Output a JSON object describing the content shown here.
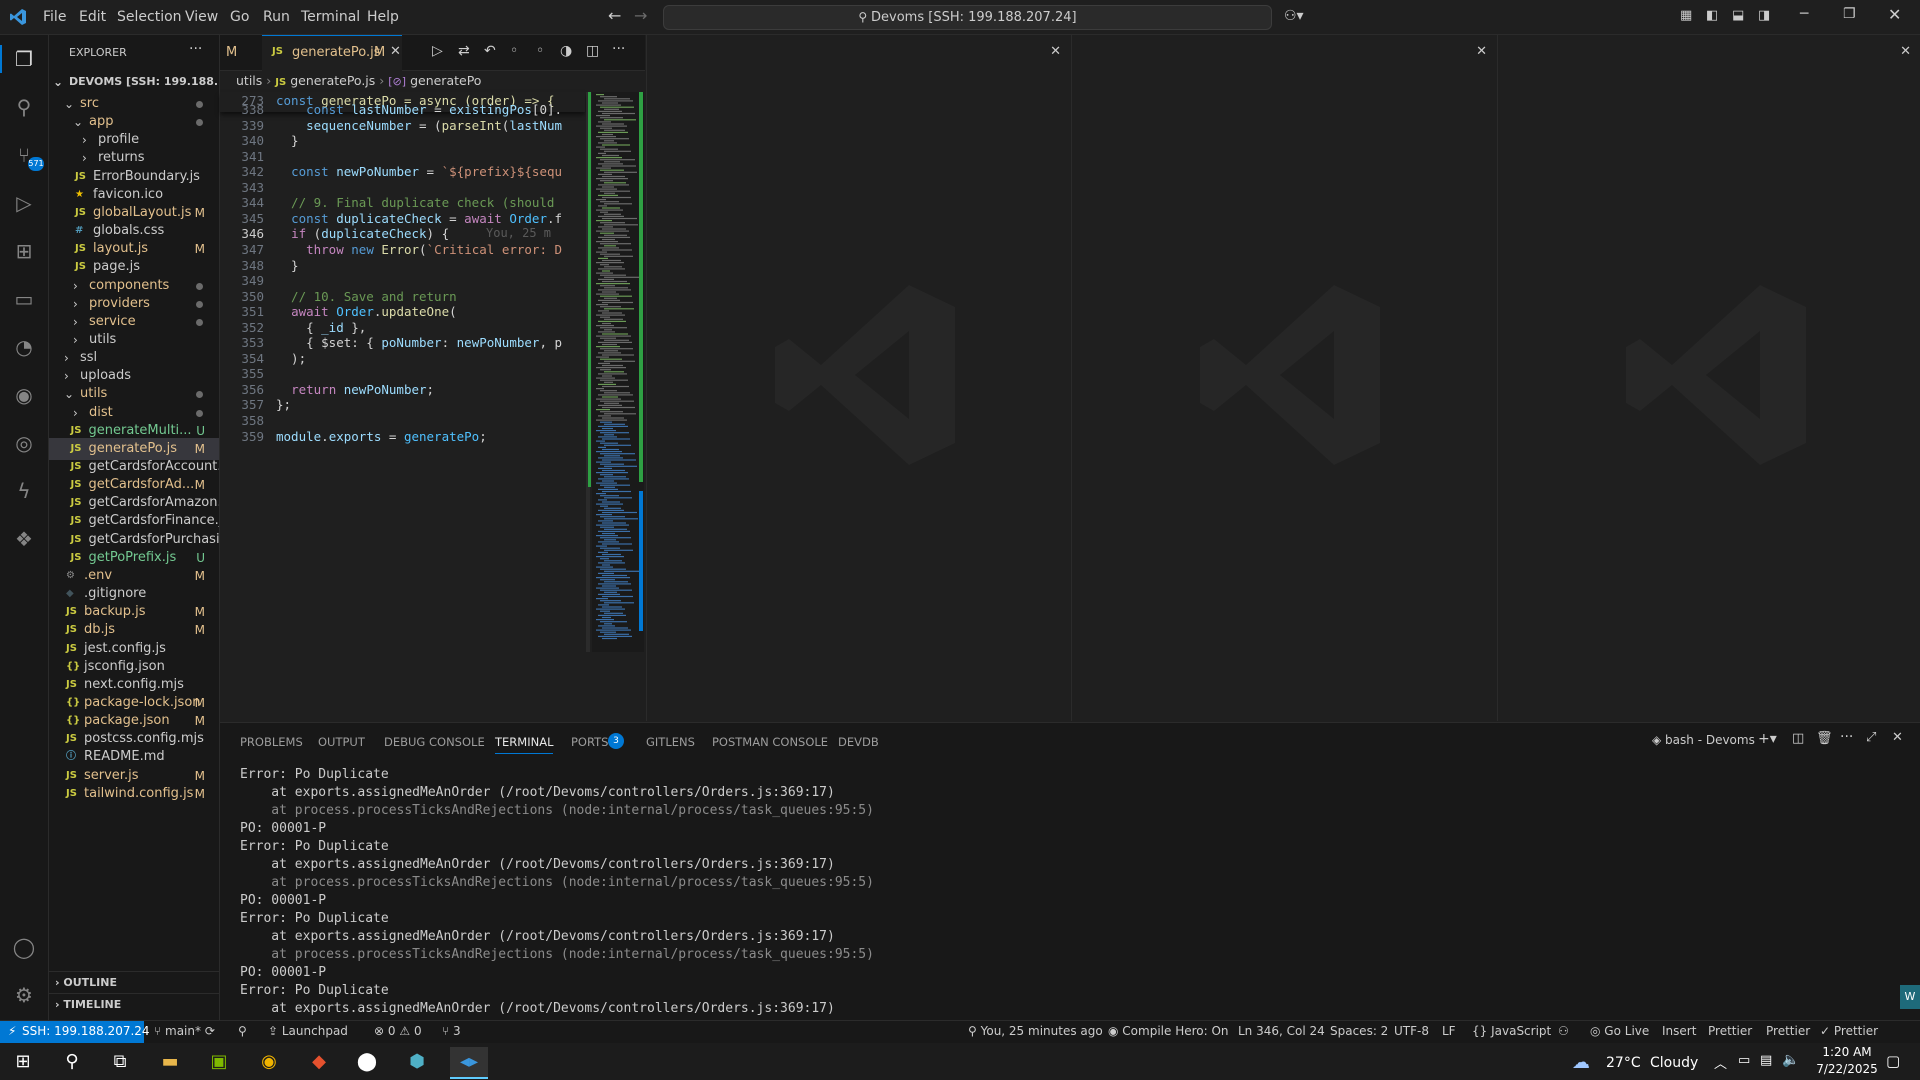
{
  "titlebar": {
    "menus": [
      "File",
      "Edit",
      "Selection",
      "View",
      "Go",
      "Run",
      "Terminal",
      "Help"
    ],
    "command_center": "Devoms [SSH: 199.188.207.24]"
  },
  "activity_bar": {
    "scm_badge": "571"
  },
  "sidebar": {
    "title": "EXPLORER",
    "root": "DEVOMS [SSH: 199.188.20...",
    "items": [
      {
        "label": "src",
        "status": "dot"
      },
      {
        "label": "app",
        "status": "dot"
      },
      {
        "label": "profile",
        "status": ""
      },
      {
        "label": "returns",
        "status": ""
      },
      {
        "label": "ErrorBoundary.js",
        "status": ""
      },
      {
        "label": "favicon.ico",
        "status": ""
      },
      {
        "label": "globalLayout.js",
        "status": "M"
      },
      {
        "label": "globals.css",
        "status": ""
      },
      {
        "label": "layout.js",
        "status": "M"
      },
      {
        "label": "page.js",
        "status": ""
      },
      {
        "label": "components",
        "status": "dot"
      },
      {
        "label": "providers",
        "status": "dot"
      },
      {
        "label": "service",
        "status": "dot"
      },
      {
        "label": "utils",
        "status": ""
      },
      {
        "label": "ssl",
        "status": ""
      },
      {
        "label": "uploads",
        "status": ""
      },
      {
        "label": "utils",
        "status": "dot"
      },
      {
        "label": "dist",
        "status": "dot"
      },
      {
        "label": "generateMulti...",
        "status": "U"
      },
      {
        "label": "generatePo.js",
        "status": "M"
      },
      {
        "label": "getCardsforAccount.js",
        "status": ""
      },
      {
        "label": "getCardsforAd...",
        "status": "M"
      },
      {
        "label": "getCardsforAmazon.js",
        "status": ""
      },
      {
        "label": "getCardsforFinance.js",
        "status": ""
      },
      {
        "label": "getCardsforPurchasi...",
        "status": ""
      },
      {
        "label": "getPoPrefix.js",
        "status": "U"
      },
      {
        "label": ".env",
        "status": "M"
      },
      {
        "label": ".gitignore",
        "status": ""
      },
      {
        "label": "backup.js",
        "status": "M"
      },
      {
        "label": "db.js",
        "status": "M"
      },
      {
        "label": "jest.config.js",
        "status": ""
      },
      {
        "label": "jsconfig.json",
        "status": ""
      },
      {
        "label": "next.config.mjs",
        "status": ""
      },
      {
        "label": "package-lock.json",
        "status": "M"
      },
      {
        "label": "package.json",
        "status": "M"
      },
      {
        "label": "postcss.config.mjs",
        "status": ""
      },
      {
        "label": "README.md",
        "status": ""
      },
      {
        "label": "server.js",
        "status": "M"
      },
      {
        "label": "tailwind.config.js",
        "status": "M"
      }
    ],
    "outline": "OUTLINE",
    "timeline": "TIMELINE"
  },
  "editor": {
    "prev_tab_status": "M",
    "tab_label": "generatePo.js",
    "tab_status": "M",
    "breadcrumb": [
      "utils",
      "generatePo.js",
      "generatePo"
    ],
    "sticky_line": "273",
    "sticky_code": "const generatePo = async (order) => {",
    "blame": "You, 25 m",
    "lines": [
      {
        "n": "338",
        "t": "    const lastNumber = existingPos[0]."
      },
      {
        "n": "339",
        "t": "    sequenceNumber = (parseInt(lastNum"
      },
      {
        "n": "340",
        "t": "  }"
      },
      {
        "n": "341",
        "t": ""
      },
      {
        "n": "342",
        "t": "  const newPoNumber = `${prefix}${sequ"
      },
      {
        "n": "343",
        "t": ""
      },
      {
        "n": "344",
        "t": "  // 9. Final duplicate check (should"
      },
      {
        "n": "345",
        "t": "  const duplicateCheck = await Order.f"
      },
      {
        "n": "346",
        "t": "  if (duplicateCheck) {"
      },
      {
        "n": "347",
        "t": "    throw new Error(`Critical error: D"
      },
      {
        "n": "348",
        "t": "  }"
      },
      {
        "n": "349",
        "t": ""
      },
      {
        "n": "350",
        "t": "  // 10. Save and return"
      },
      {
        "n": "351",
        "t": "  await Order.updateOne("
      },
      {
        "n": "352",
        "t": "    { _id },"
      },
      {
        "n": "353",
        "t": "    { $set: { poNumber: newPoNumber, p"
      },
      {
        "n": "354",
        "t": "  );"
      },
      {
        "n": "355",
        "t": ""
      },
      {
        "n": "356",
        "t": "  return newPoNumber;"
      },
      {
        "n": "357",
        "t": "};"
      },
      {
        "n": "358",
        "t": ""
      },
      {
        "n": "359",
        "t": "module.exports = generatePo;"
      }
    ]
  },
  "panel": {
    "tabs": [
      "PROBLEMS",
      "OUTPUT",
      "DEBUG CONSOLE",
      "TERMINAL",
      "PORTS",
      "GITLENS",
      "POSTMAN CONSOLE",
      "DEVDB"
    ],
    "active_tab": "TERMINAL",
    "ports_badge": "3",
    "terminal_name": "bash - Devoms",
    "terminal_lines": [
      "Error: Po Duplicate",
      "    at exports.assignedMeAnOrder (/root/Devoms/controllers/Orders.js:369:17)",
      "    at process.processTicksAndRejections (node:internal/process/task_queues:95:5)",
      "PO: 00001-P",
      "Error: Po Duplicate",
      "    at exports.assignedMeAnOrder (/root/Devoms/controllers/Orders.js:369:17)",
      "    at process.processTicksAndRejections (node:internal/process/task_queues:95:5)",
      "PO: 00001-P",
      "Error: Po Duplicate",
      "    at exports.assignedMeAnOrder (/root/Devoms/controllers/Orders.js:369:17)",
      "    at process.processTicksAndRejections (node:internal/process/task_queues:95:5)",
      "PO: 00001-P",
      "Error: Po Duplicate",
      "    at exports.assignedMeAnOrder (/root/Devoms/controllers/Orders.js:369:17)"
    ]
  },
  "statusbar": {
    "remote": "SSH: 199.188.207.24",
    "branch": "main*",
    "launchpad": "Launchpad",
    "errors": "0",
    "warnings": "0",
    "ports": "3",
    "blame": "You, 25 minutes ago",
    "compile_hero": "Compile Hero: On",
    "position": "Ln 346, Col 24",
    "spaces": "Spaces: 2",
    "encoding": "UTF-8",
    "eol": "LF",
    "language": "JavaScript",
    "golive": "Go Live",
    "insert": "Insert",
    "prettier1": "Prettier",
    "prettier2": "Prettier",
    "prettier3": "Prettier"
  },
  "taskbar": {
    "weather_temp": "27°C",
    "weather_desc": "Cloudy",
    "time": "1:20 AM",
    "date": "7/22/2025"
  },
  "colors": {
    "accent": "#0078d4",
    "remote_bg": "#0078d4",
    "modified": "#e2c08d",
    "untracked": "#73c991"
  }
}
